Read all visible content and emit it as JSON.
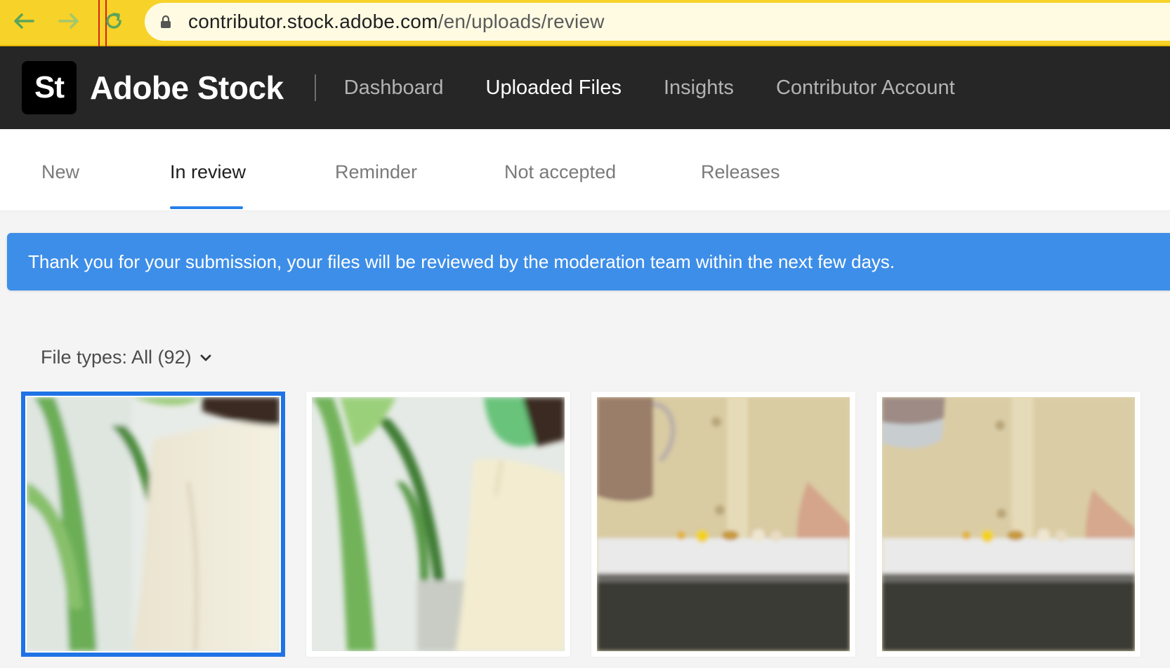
{
  "browser": {
    "url_host": "contributor.stock.adobe.com",
    "url_path": "/en/uploads/review",
    "icons": [
      "back-arrow-icon",
      "forward-arrow-icon",
      "reload-icon",
      "lock-icon"
    ]
  },
  "header": {
    "logo_text": "St",
    "brand": "Adobe Stock",
    "nav": [
      {
        "label": "Dashboard",
        "active": false
      },
      {
        "label": "Uploaded Files",
        "active": true
      },
      {
        "label": "Insights",
        "active": false
      },
      {
        "label": "Contributor Account",
        "active": false
      }
    ]
  },
  "tabs": [
    {
      "label": "New",
      "active": false
    },
    {
      "label": "In review",
      "active": true
    },
    {
      "label": "Reminder",
      "active": false
    },
    {
      "label": "Not accepted",
      "active": false
    },
    {
      "label": "Releases",
      "active": false
    }
  ],
  "banner": {
    "message": "Thank you for your submission, your files will be reviewed by the moderation team within the next few days.",
    "color": "#3d8ee8"
  },
  "filter": {
    "label": "File types: All (92)",
    "icon": "chevron-down-icon"
  },
  "thumbnails": [
    {
      "subject": "person in cream shirt beside green plant",
      "selected": true
    },
    {
      "subject": "person wearing green face mask beside plant",
      "selected": false
    },
    {
      "subject": "glass of water with pills on countertop",
      "selected": false
    },
    {
      "subject": "glass being lifted above pills on countertop",
      "selected": false
    }
  ],
  "colors": {
    "browser_bar": "#f7d228",
    "header_bg": "#262626",
    "accent": "#2680eb",
    "selection": "#1f73e6"
  }
}
